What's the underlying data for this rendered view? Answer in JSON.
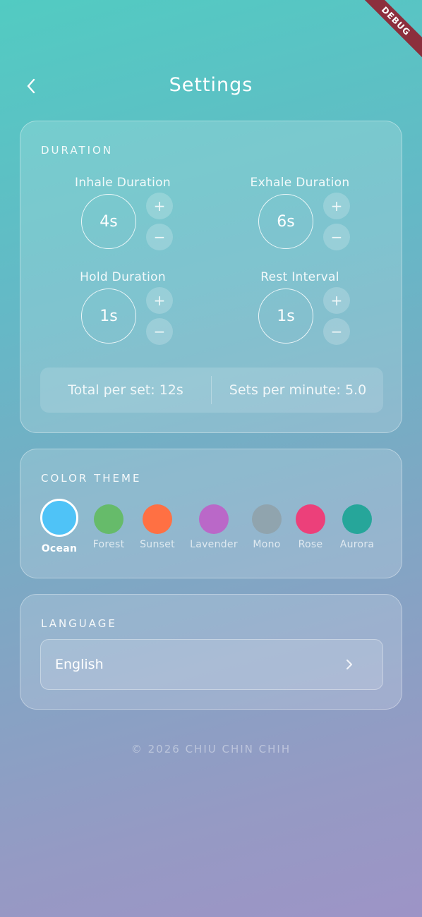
{
  "debug_banner": "DEBUG",
  "header": {
    "title": "Settings",
    "back_icon": "chevron-left-icon"
  },
  "duration": {
    "section_title": "DURATION",
    "controls": [
      {
        "label": "Inhale Duration",
        "value": "4s",
        "plus": "+",
        "minus": "−"
      },
      {
        "label": "Exhale Duration",
        "value": "6s",
        "plus": "+",
        "minus": "−"
      },
      {
        "label": "Hold Duration",
        "value": "1s",
        "plus": "+",
        "minus": "−"
      },
      {
        "label": "Rest Interval",
        "value": "1s",
        "plus": "+",
        "minus": "−"
      }
    ],
    "total_per_set": "Total per set: 12s",
    "sets_per_minute": "Sets per minute: 5.0"
  },
  "color_theme": {
    "section_title": "COLOR THEME",
    "selected": "Ocean",
    "themes": [
      {
        "name": "Ocean",
        "color": "#4fc3f7"
      },
      {
        "name": "Forest",
        "color": "#66bb6a"
      },
      {
        "name": "Sunset",
        "color": "#ff7043"
      },
      {
        "name": "Lavender",
        "color": "#ba68c8"
      },
      {
        "name": "Mono",
        "color": "#90a4ae"
      },
      {
        "name": "Rose",
        "color": "#ec407a"
      },
      {
        "name": "Aurora",
        "color": "#26a69a"
      }
    ]
  },
  "language": {
    "section_title": "LANGUAGE",
    "value": "English",
    "chevron_icon": "chevron-right-icon"
  },
  "footer": "© 2026 CHIU CHIN CHIH"
}
